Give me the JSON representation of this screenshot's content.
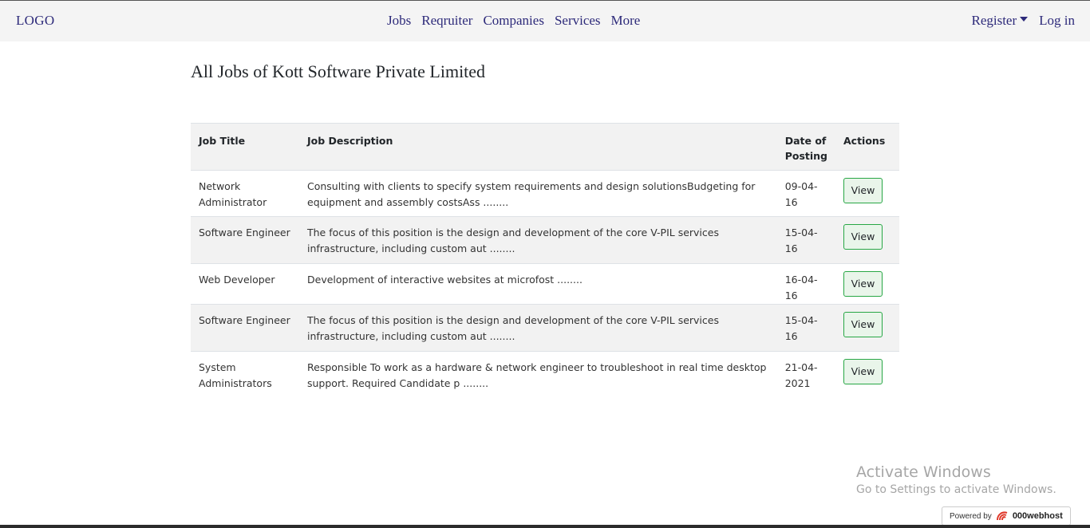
{
  "navbar": {
    "logo": "LOGO",
    "links": [
      "Jobs",
      "Reqruiter",
      "Companies",
      "Services",
      "More"
    ],
    "register": "Register",
    "login": "Log in"
  },
  "page": {
    "title": "All Jobs of Kott Software Private Limited"
  },
  "table": {
    "headers": [
      "Job Title",
      "Job Description",
      "Date of Posting",
      "Actions"
    ],
    "rows": [
      {
        "title": "Network Administrator",
        "description": "Consulting with clients to specify system requirements and design solutionsBudgeting for equipment and assembly costsAss ........",
        "date": "09-04-16",
        "action": "View"
      },
      {
        "title": "Software Engineer",
        "description": "The focus of this position is the design and development of the core V-PIL services infrastructure, including custom aut ........",
        "date": "15-04-16",
        "action": "View"
      },
      {
        "title": "Web Developer",
        "description": "Development of interactive websites at microfost ........",
        "date": "16-04-16",
        "action": "View"
      },
      {
        "title": "Software Engineer",
        "description": "The focus of this position is the design and development of the core V-PIL services infrastructure, including custom aut ........",
        "date": "15-04-16",
        "action": "View"
      },
      {
        "title": "System Administrators",
        "description": "Responsible To work as a hardware & network engineer to troubleshoot in real time desktop support. Required Candidate p ........",
        "date": "21-04-2021",
        "action": "View"
      }
    ]
  },
  "watermark": {
    "line1": "Activate Windows",
    "line2": "Go to Settings to activate Windows."
  },
  "powered_badge": {
    "prefix": "Powered by",
    "brand": "000webhost"
  }
}
